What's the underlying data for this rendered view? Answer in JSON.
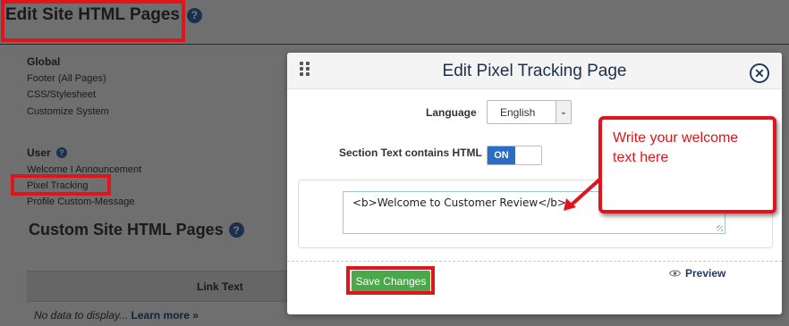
{
  "background": {
    "page_title": "Edit Site HTML Pages",
    "groups": {
      "global_title": "Global",
      "global_links": [
        "Footer (All Pages)",
        "CSS/Stylesheet",
        "Customize System"
      ],
      "user_title": "User",
      "user_links": [
        "Welcome I Announcement",
        "Pixel Tracking",
        "Profile Custom-Message"
      ]
    },
    "custom_title": "Custom Site HTML Pages",
    "table_header": "Link Text",
    "no_data_text": "No data to display...",
    "learn_more": "Learn more »"
  },
  "modal": {
    "title": "Edit Pixel Tracking Page",
    "language_label": "Language",
    "language_value": "English",
    "section_html_label": "Section Text contains HTML",
    "toggle_state": "ON",
    "editor_content": "<b>Welcome to Customer Review</b>",
    "save_label": "Save Changes",
    "preview_label": "Preview"
  },
  "annotation": {
    "callout_text": "Write your welcome text here",
    "highlight_color": "#e0141b"
  },
  "colors": {
    "accent": "#1e3a66",
    "save_green": "#4aa84a",
    "toggle_blue": "#2b6cc4"
  }
}
